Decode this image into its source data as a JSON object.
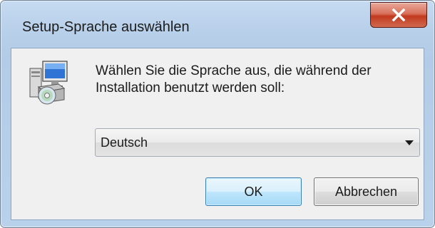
{
  "window": {
    "title": "Setup-Sprache auswählen"
  },
  "dialog": {
    "icon": "setup-installer-icon",
    "prompt": "Wählen Sie die Sprache aus, die während der Installation benutzt werden soll:",
    "language_select": {
      "selected": "Deutsch"
    },
    "ok_label": "OK",
    "cancel_label": "Abbrechen"
  },
  "colors": {
    "frame": "#b9d1ea",
    "client": "#f0f0f0",
    "close_button": "#c2391f",
    "ok_border": "#3c7fb1"
  }
}
